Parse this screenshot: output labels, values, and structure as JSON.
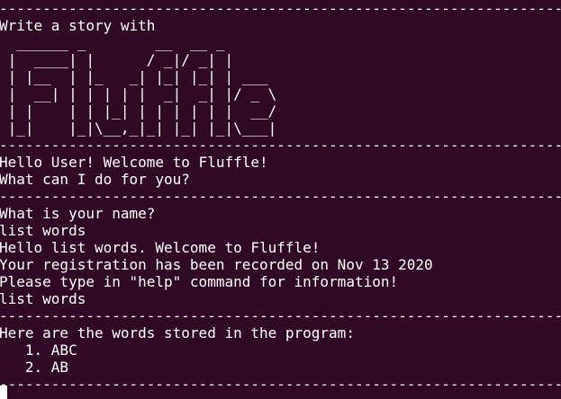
{
  "terminal": {
    "background": "#300a24",
    "foreground": "#ffffff",
    "separator": "------------------------------------------------------------------------------",
    "intro": "Write a story with",
    "logo_lines": [
      "  ______ _        __  __ _",
      " |  ____| |      / _|/ _| |",
      " | |__  | |_   _| |_| |_| | ___",
      " |  __| | | | | |  _|  _| |/ _ \\",
      " | |    | | |_| | | | | | |  __/",
      " |_|    |_|\\__,_|_| |_| |_|\\___|"
    ],
    "greeting": "Hello User! Welcome to Fluffle!",
    "prompt": "What can I do for you?",
    "name_question": "What is your name?",
    "name_input": "list words",
    "welcome_user": "Hello list words. Welcome to Fluffle!",
    "registration": "Your registration has been recorded on Nov 13 2020",
    "help_hint": "Please type in \"help\" command for information!",
    "command_input": "list words",
    "words_header": "Here are the words stored in the program:",
    "words": [
      "   1. ABC",
      "   2. AB"
    ]
  }
}
